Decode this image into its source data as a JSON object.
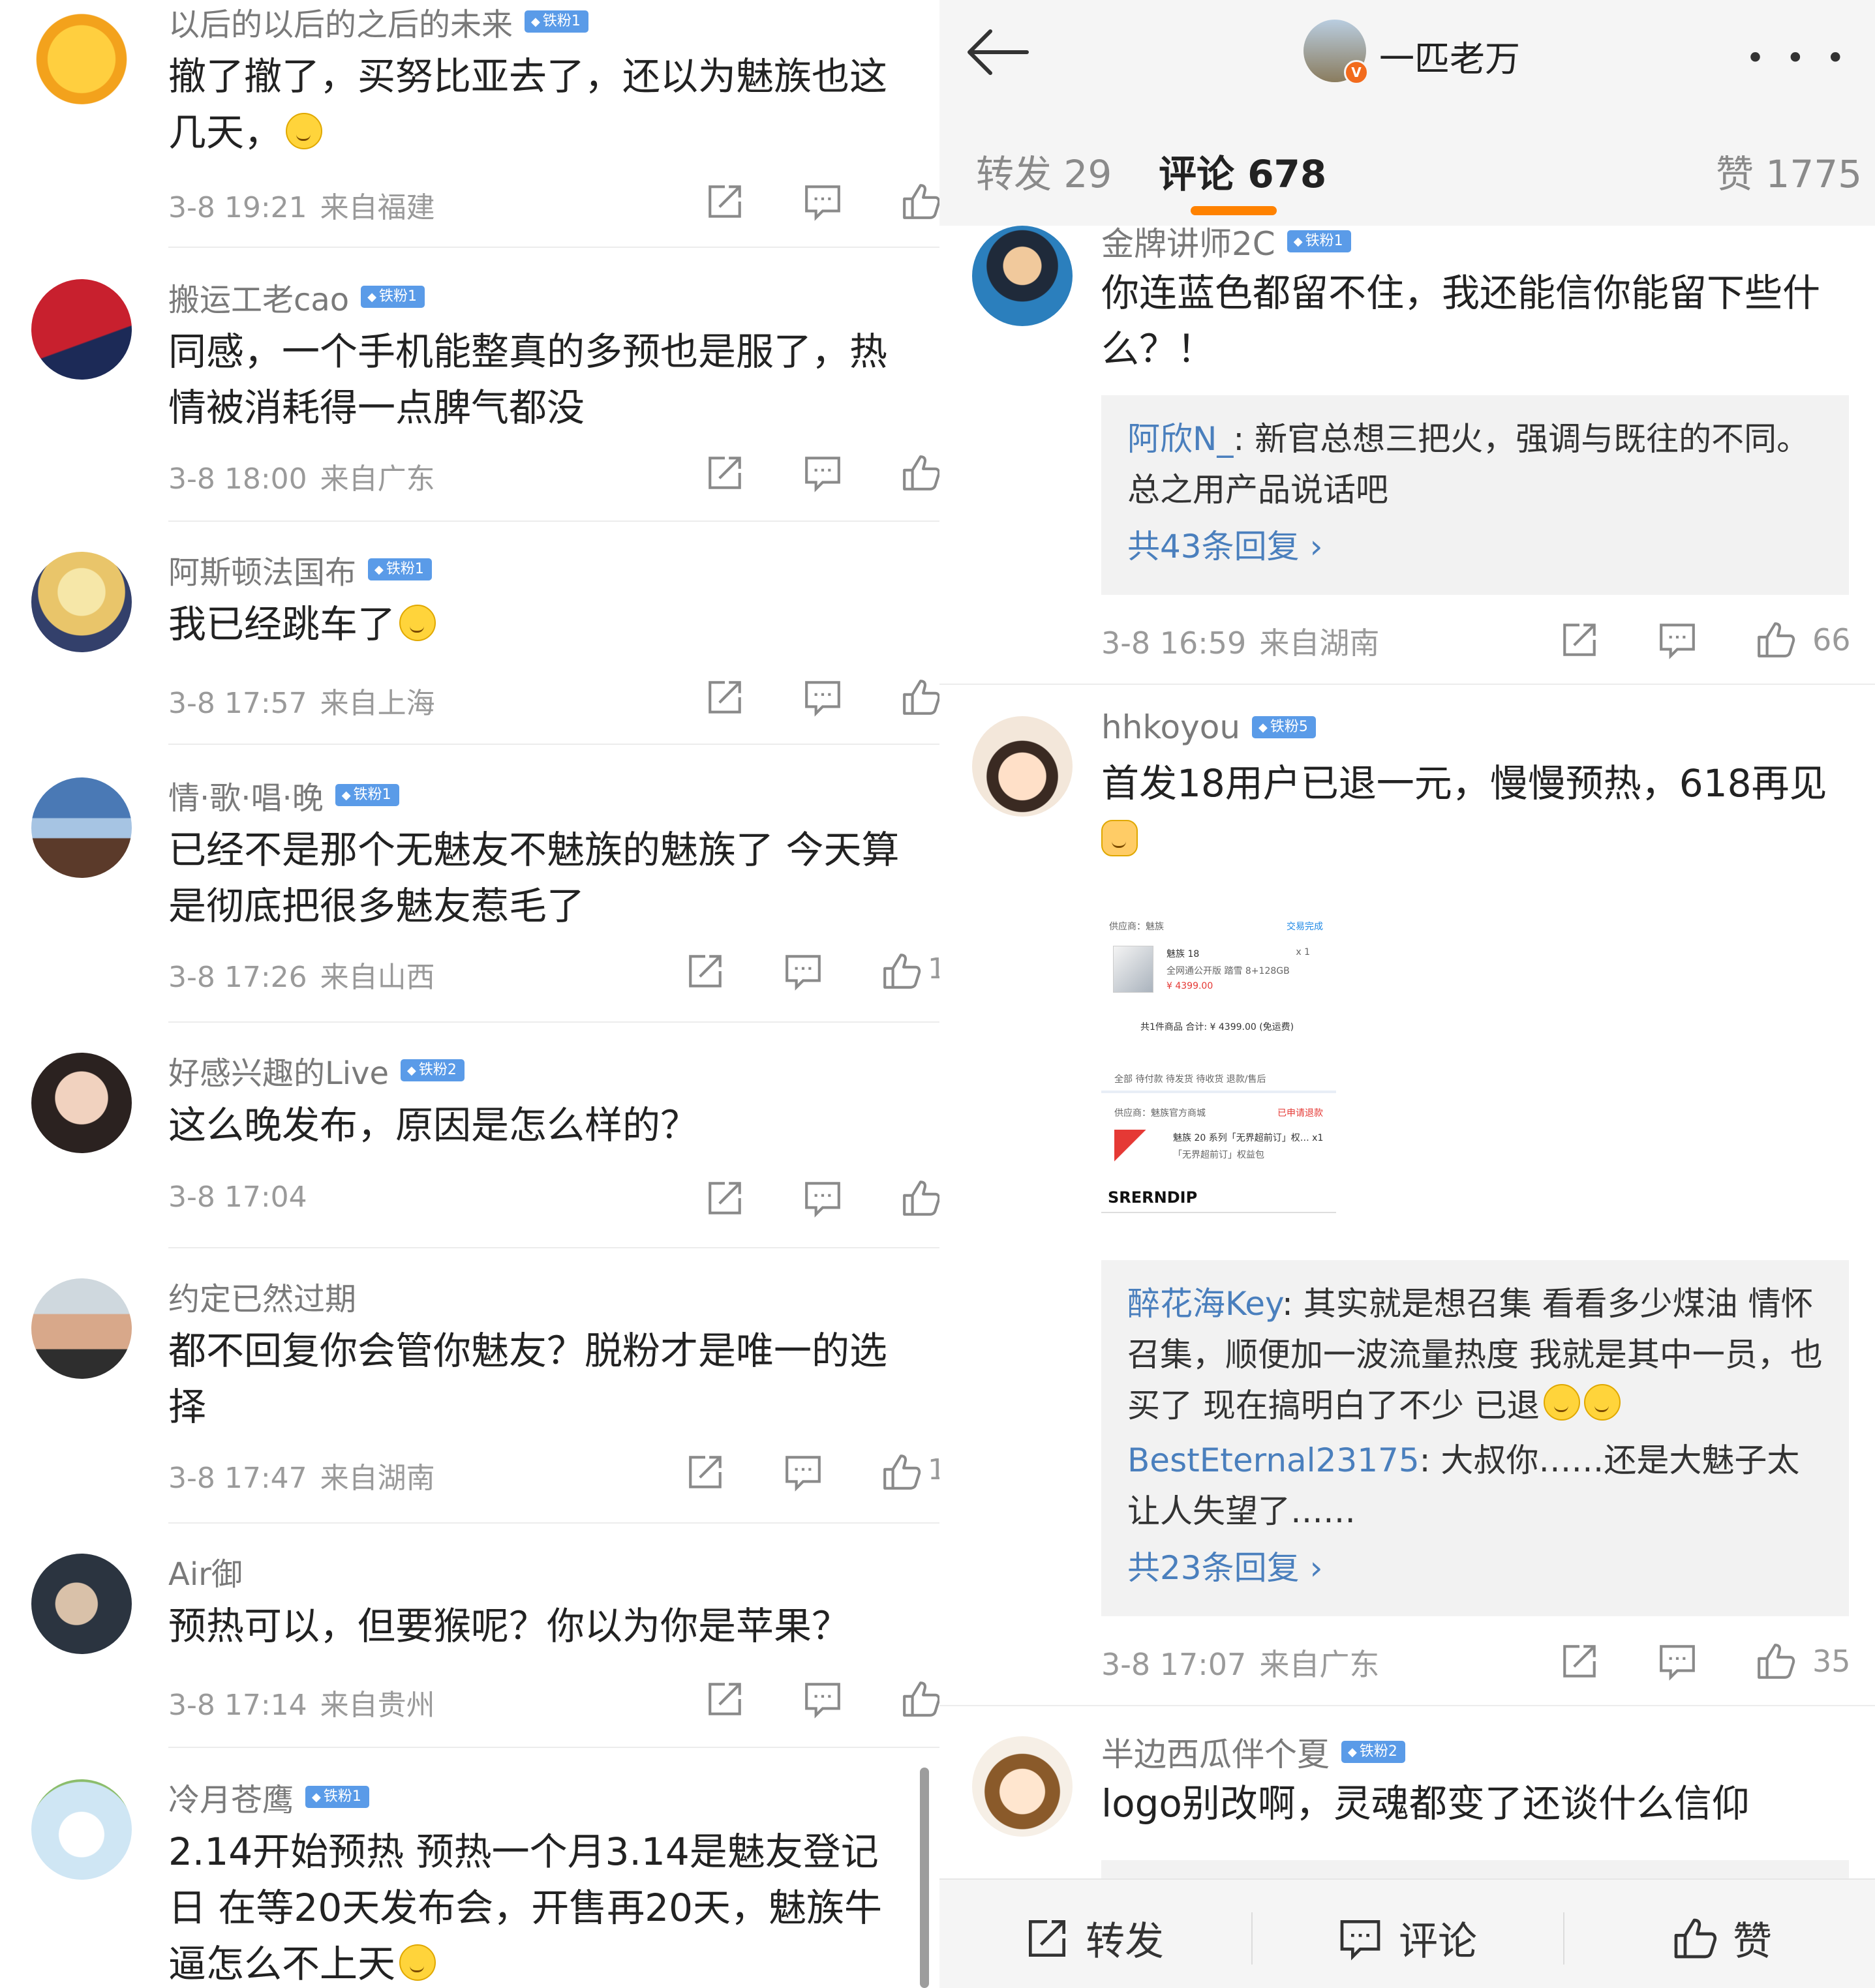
{
  "left": {
    "comments": [
      {
        "user": "以后的以后的之后的未来",
        "badge": "铁粉1",
        "text": "撤了撤了，买努比亚去了，还以为魅族也这几天，",
        "time": "3-8 19:21",
        "loc": "来自福建",
        "likes": ""
      },
      {
        "user": "搬运工老cao",
        "badge": "铁粉1",
        "text": "同感，一个手机能整真的多预也是服了，热情被消耗得一点脾气都没",
        "time": "3-8 18:00",
        "loc": "来自广东",
        "likes": ""
      },
      {
        "user": "阿斯顿法国布",
        "badge": "铁粉1",
        "text": "我已经跳车了",
        "time": "3-8 17:57",
        "loc": "来自上海",
        "likes": ""
      },
      {
        "user": "情·歌·唱·晚",
        "badge": "铁粉1",
        "text": "已经不是那个无魅友不魅族的魅族了 今天算是彻底把很多魅友惹毛了",
        "time": "3-8 17:26",
        "loc": "来自山西",
        "likes": "1"
      },
      {
        "user": "好感兴趣的Live",
        "badge": "铁粉2",
        "text": "这么晚发布，原因是怎么样的？",
        "time": "3-8 17:04",
        "loc": "",
        "likes": ""
      },
      {
        "user": "约定已然过期",
        "badge": "",
        "text": "都不回复你会管你魅友？脱粉才是唯一的选择",
        "time": "3-8 17:47",
        "loc": "来自湖南",
        "likes": "1"
      },
      {
        "user": "Air御",
        "badge": "",
        "text": "预热可以，但要猴呢？你以为你是苹果？",
        "time": "3-8 17:14",
        "loc": "来自贵州",
        "likes": ""
      },
      {
        "user": "冷月苍鹰",
        "badge": "铁粉1",
        "text": "2.14开始预热 预热一个月3.14是魅友登记日 在等20天发布会，开售再20天，魅族牛逼怎么不上天",
        "time": "",
        "loc": "",
        "likes": ""
      }
    ]
  },
  "right": {
    "title": "一匹老万",
    "tabs": {
      "repost": "转发 29",
      "comment": "评论 678",
      "like": "赞 1775"
    },
    "c1": {
      "user": "金牌讲师2C",
      "badge": "铁粉1",
      "text": "你连蓝色都留不住，我还能信你能留下些什么？！",
      "reply1_user": "阿欣N_",
      "reply1_text": ": 新官总想三把火，强调与既往的不同。总之用产品说话吧",
      "more": "共43条回复 ›",
      "time": "3-8 16:59",
      "loc": "来自湖南",
      "likes": "66"
    },
    "c2": {
      "user": "hhkoyou",
      "badge": "铁粉5",
      "text": "首发18用户已退一元，慢慢预热，618再见",
      "reply1_user": "醉花海Key",
      "reply1_text": ": 其实就是想召集 看看多少煤油 情怀召集，顺便加一波流量热度 我就是其中一员，也买了 现在搞明白了不少 已退",
      "reply2_user": "BestEternal23175",
      "reply2_text": ": 大叔你……还是大魅子太让人失望了……",
      "more": "共23条回复 ›",
      "time": "3-8 17:07",
      "loc": "来自广东",
      "likes": "35"
    },
    "c3": {
      "user": "半边西瓜伴个夏",
      "badge": "铁粉2",
      "text": "logo别改啊，灵魂都变了还谈什么信仰"
    },
    "embed": {
      "supplier": "供应商：魅族",
      "status": "交易完成",
      "product": "魅族 18",
      "qty": "x 1",
      "spec": "全网通公开版 踏雪 8+128GB",
      "price": "¥ 4399.00",
      "total": "共1件商品  合计: ¥ 4399.00 (免运费)",
      "tabs": "全部  待付款  待发货  待收货  退款/售后",
      "supplier2": "供应商：魅族官方商城",
      "status2": "已申请退款",
      "product2": "魅族 20 系列「无界超前订」权…  x1",
      "spec2": "「无界超前订」权益包",
      "brand": "SRERNDIP"
    },
    "bottom": {
      "repost": "转发",
      "comment": "评论",
      "like": "赞"
    }
  }
}
